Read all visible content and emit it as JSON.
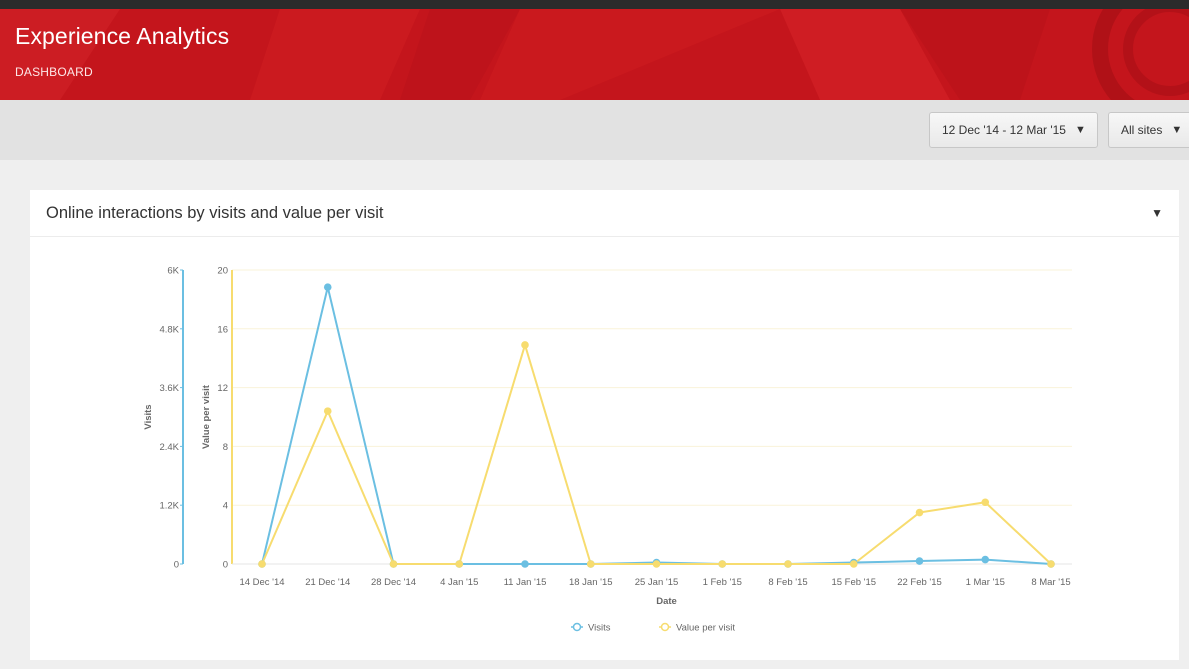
{
  "app": {
    "title": "Experience Analytics",
    "section": "DASHBOARD"
  },
  "filters": {
    "date_range": "12 Dec '14 - 12 Mar '15",
    "sites": "All sites",
    "caret": "▼"
  },
  "panel": {
    "title": "Online interactions by visits and value per visit",
    "toggle": "▼"
  },
  "colors": {
    "brand": "#c4151c",
    "visits": "#6bbfe2",
    "value_per_visit": "#f7dc6f"
  },
  "chart_data": {
    "type": "line",
    "x": [
      "14 Dec '14",
      "21 Dec '14",
      "28 Dec '14",
      "4 Jan '15",
      "11 Jan '15",
      "18 Jan '15",
      "25 Jan '15",
      "1 Feb '15",
      "8 Feb '15",
      "15 Feb '15",
      "22 Feb '15",
      "1 Mar '15",
      "8 Mar '15"
    ],
    "xlabel": "Date",
    "series": [
      {
        "name": "Visits",
        "axis": "left",
        "values": [
          0,
          5650,
          0,
          0,
          0,
          0,
          30,
          0,
          0,
          30,
          60,
          90,
          0
        ]
      },
      {
        "name": "Value per visit",
        "axis": "right",
        "values": [
          0,
          10.4,
          0,
          0,
          14.9,
          0,
          0,
          0,
          0,
          0,
          3.5,
          4.2,
          0
        ]
      }
    ],
    "y_left": {
      "label": "Visits",
      "range": [
        0,
        6000
      ],
      "ticks": [
        "0",
        "1.2K",
        "2.4K",
        "3.6K",
        "4.8K",
        "6K"
      ]
    },
    "y_right": {
      "label": "Value per visit",
      "range": [
        0,
        20
      ],
      "ticks": [
        "0",
        "4",
        "8",
        "12",
        "16",
        "20"
      ]
    },
    "legend": "bottom-center",
    "grid": true
  }
}
